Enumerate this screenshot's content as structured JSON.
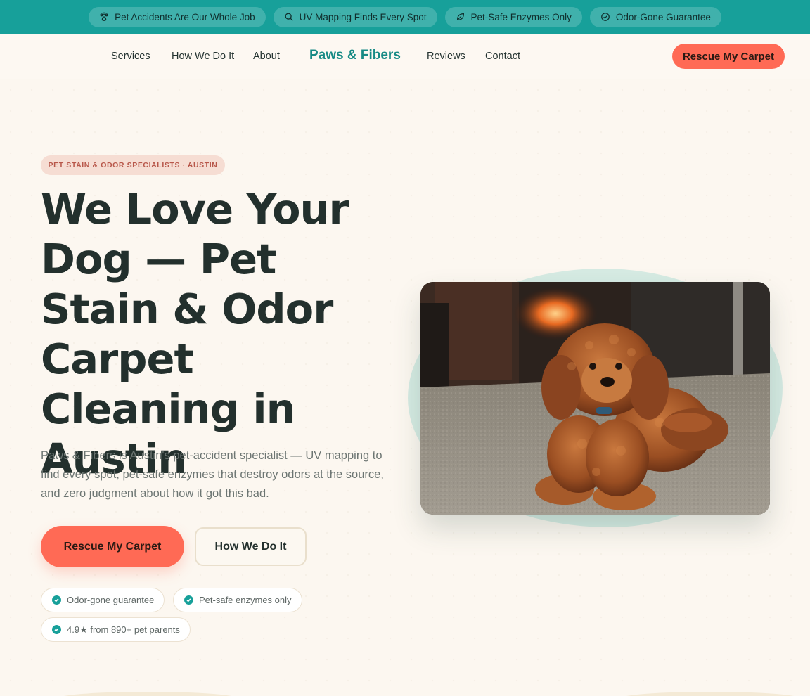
{
  "topbar": {
    "pills": [
      {
        "icon": "paw-icon",
        "label": "Pet Accidents Are Our Whole Job"
      },
      {
        "icon": "search-icon",
        "label": "UV Mapping Finds Every Spot"
      },
      {
        "icon": "leaf-icon",
        "label": "Pet-Safe Enzymes Only"
      },
      {
        "icon": "check-circle-icon",
        "label": "Odor-Gone Guarantee"
      }
    ]
  },
  "nav": {
    "links": [
      "Services",
      "How We Do It",
      "About",
      "Reviews",
      "Contact"
    ],
    "logo": "Paws & Fibers",
    "cta": "Rescue My Carpet"
  },
  "hero": {
    "eyebrow": "PET STAIN & ODOR SPECIALISTS · AUSTIN",
    "headline": "We Love Your Dog — Pet Stain & Odor Carpet Cleaning in Austin",
    "lede": "Paws & Fibers is Austin's pet-accident specialist — UV mapping to find every spot, pet-safe enzymes that destroy odors at the source, and zero judgment about how it got this bad.",
    "primary_cta": "Rescue My Carpet",
    "secondary_cta": "How We Do It",
    "badges": [
      "Odor-gone guarantee",
      "Pet-safe enzymes only",
      "4.9★ from 890+ pet parents"
    ]
  },
  "colors": {
    "teal": "#17a09a",
    "coral": "#ff6a55",
    "cream": "#fcf7f0",
    "ink": "#23302d"
  }
}
